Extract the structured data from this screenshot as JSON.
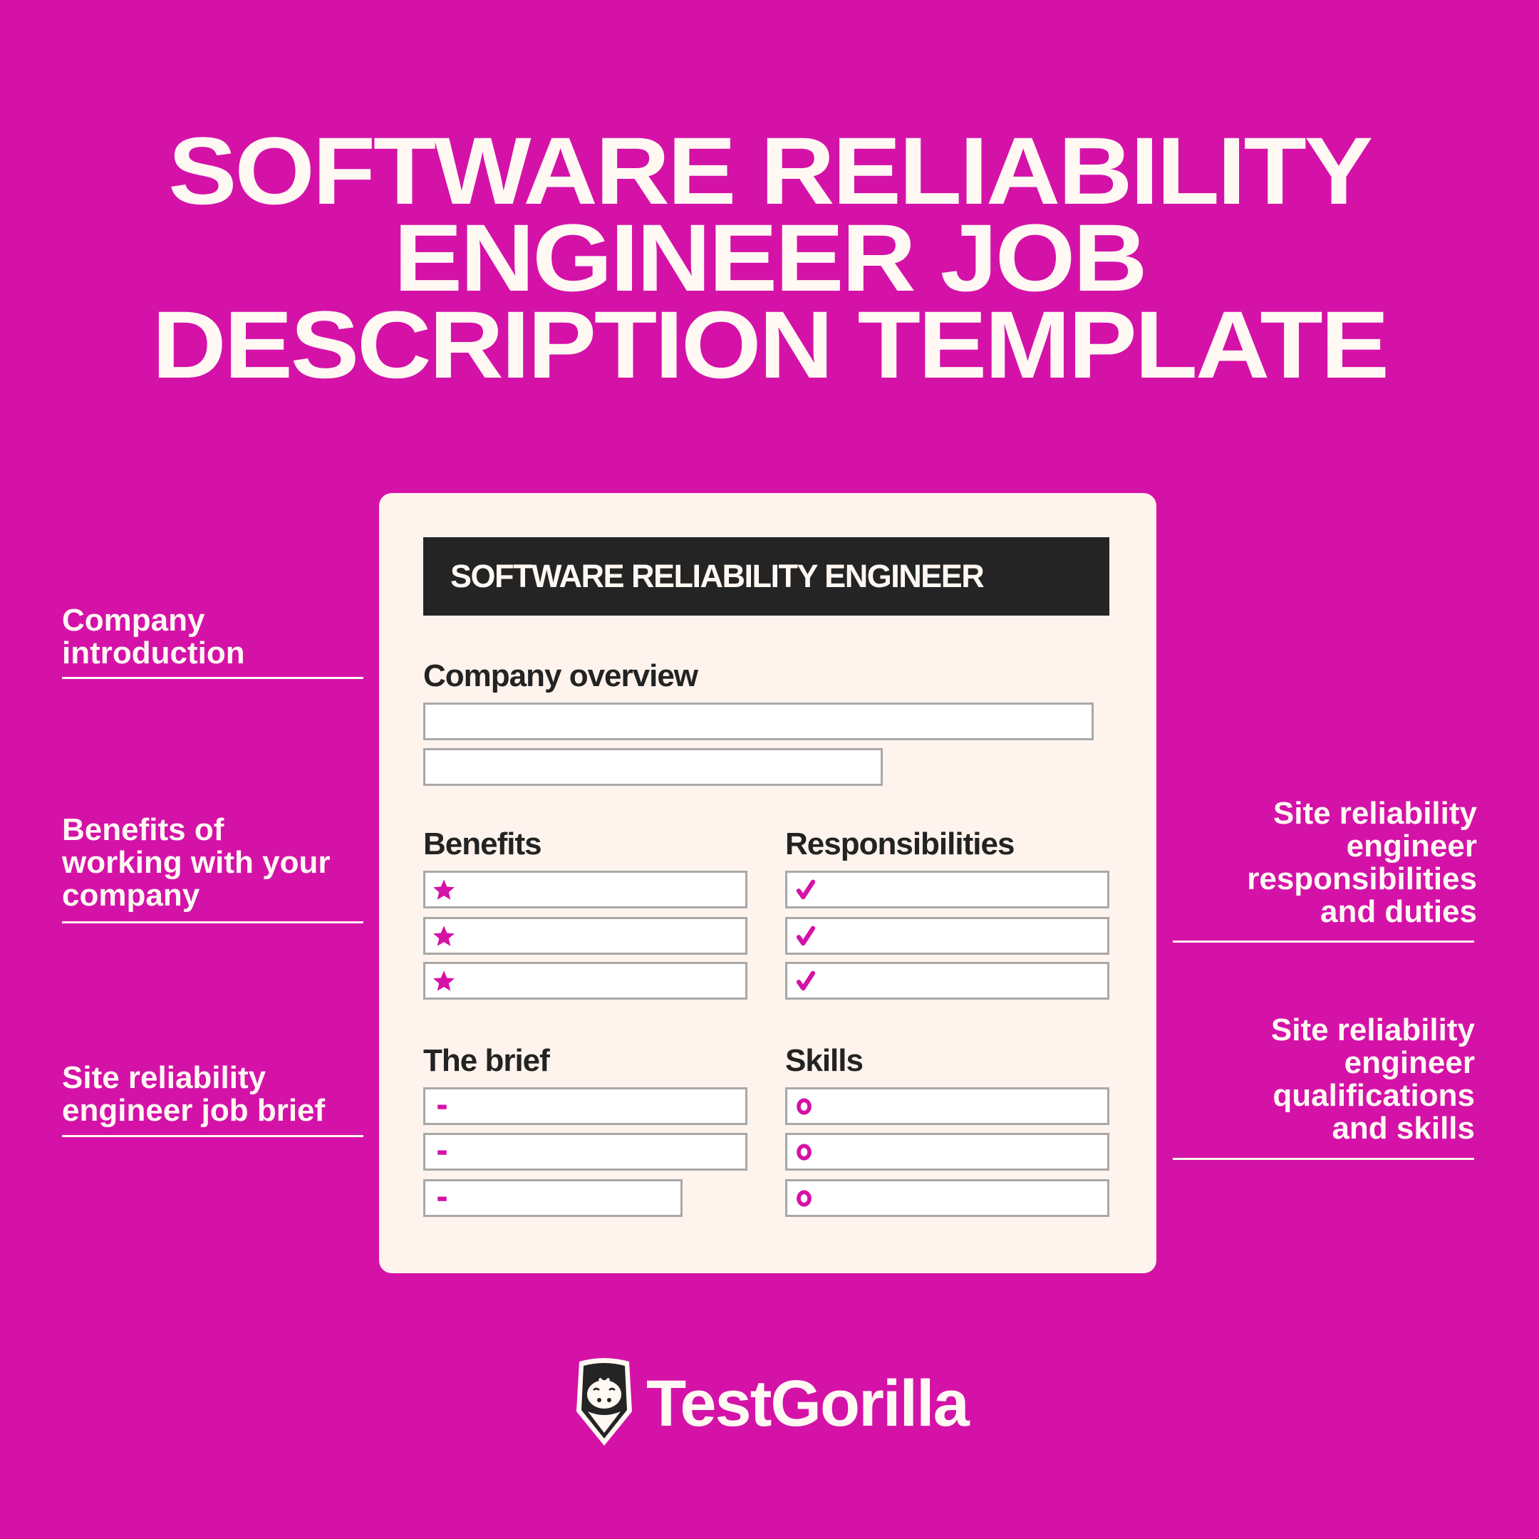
{
  "title": {
    "lines": [
      "SOFTWARE RELIABILITY",
      "ENGINEER JOB",
      "DESCRIPTION TEMPLATE"
    ]
  },
  "colors": {
    "background": "#d412a8",
    "card": "#fff4ed",
    "banner": "#242424",
    "accent": "#d412a8",
    "text_light": "#fff8f3",
    "text_dark": "#232323"
  },
  "card": {
    "banner": "SOFTWARE RELIABILITY ENGINEER",
    "sections": {
      "overview": {
        "heading": "Company overview"
      },
      "benefits": {
        "heading": "Benefits",
        "bullet_icon": "star-icon"
      },
      "responsibilities": {
        "heading": "Responsibilities",
        "bullet_icon": "checkmark-icon"
      },
      "brief": {
        "heading": "The brief",
        "bullet_icon": "dash-icon"
      },
      "skills": {
        "heading": "Skills",
        "bullet_icon": "ring-icon"
      }
    }
  },
  "annotations": {
    "left": [
      {
        "lines": [
          "Company",
          "introduction"
        ]
      },
      {
        "lines": [
          "Benefits of",
          "working with your",
          "company"
        ]
      },
      {
        "lines": [
          "Site reliability",
          "engineer job brief"
        ]
      }
    ],
    "right": [
      {
        "lines": [
          "Site reliability",
          "engineer",
          "responsibilities",
          "and duties"
        ]
      },
      {
        "lines": [
          "Site reliability",
          "engineer",
          "qualifications",
          "and skills"
        ]
      }
    ]
  },
  "logo": {
    "text": "TestGorilla",
    "icon": "gorilla-icon"
  }
}
